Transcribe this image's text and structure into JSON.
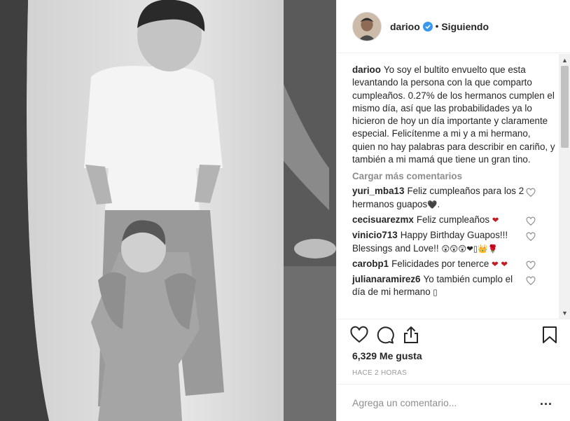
{
  "header": {
    "username": "darioo",
    "separator": "•",
    "follow_status": "Siguiendo"
  },
  "caption": {
    "username": "darioo",
    "text": "Yo soy el bultito envuelto que esta levantando la persona con la que comparto cumpleaños. 0.27% de los hermanos cumplen el mismo día, así que las probabilidades ya lo hicieron de hoy un día importante y claramente especial. Felicítenme a mi y a mi hermano, quien no hay palabras para describir en cariño, y también a mi mamá que tiene un gran tino."
  },
  "load_more_label": "Cargar más comentarios",
  "comments": [
    {
      "username": "yuri_mba13",
      "text": "Feliz cumpleaños para los 2 hermanos guapos",
      "emoji": "🖤."
    },
    {
      "username": "cecisuarezmx",
      "text": "Feliz cumpleaños",
      "emoji": "❤"
    },
    {
      "username": "vinicio713",
      "text": "Happy Birthday Guapos!!! Blessings and Love!!",
      "emoji": "😲😲😲❤▯👑🌹"
    },
    {
      "username": "carobp1",
      "text": "Felicidades por tenerce",
      "emoji": "❤ ❤"
    },
    {
      "username": "julianaramirez6",
      "text": "Yo también cumplo el día de mi hermano",
      "emoji": "▯"
    }
  ],
  "actions": {
    "like_icon": "heart-outline-icon",
    "comment_icon": "comment-bubble-icon",
    "share_icon": "share-icon",
    "save_icon": "bookmark-icon"
  },
  "likes_label": "6,329 Me gusta",
  "timestamp": "HACE 2 HORAS",
  "add_comment": {
    "placeholder": "Agrega un comentario...",
    "more_label": "..."
  },
  "colors": {
    "text": "#262626",
    "muted": "#8e8e8e",
    "verified": "#3897f0",
    "heart_red": "#c31d23",
    "border": "#efefef"
  }
}
